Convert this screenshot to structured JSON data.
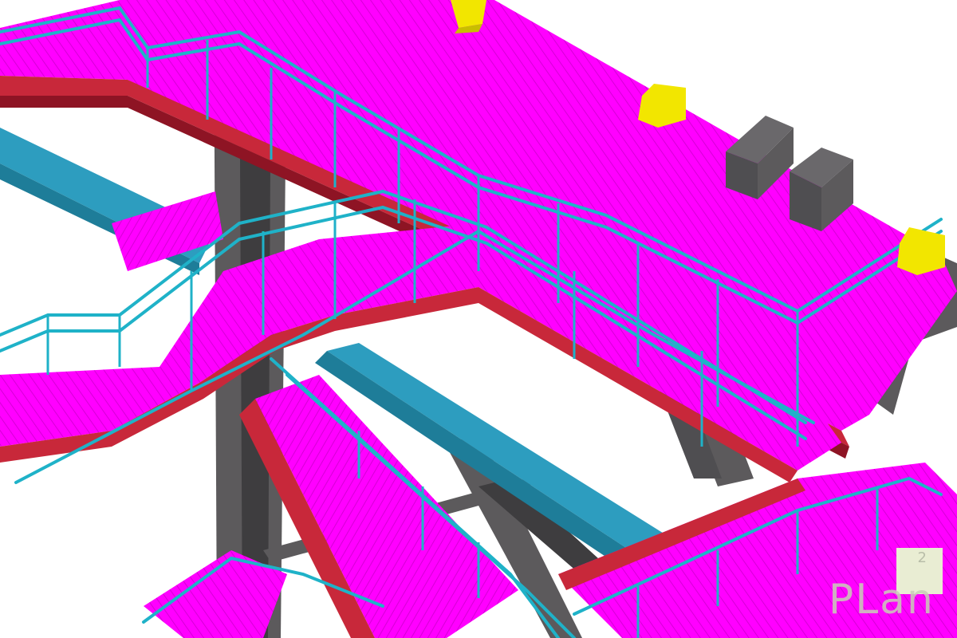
{
  "image": {
    "description_kind": "3D steel structure rendering",
    "colors": {
      "background": "#ffffff",
      "walkway": "#ff00ff",
      "walkway_shade": "#d600d6",
      "stringer": "#c8283a",
      "stringer_dark": "#8e1424",
      "railing": "#1fb2c8",
      "column": "#5c5a5c",
      "column_dark": "#3e3d3f",
      "beam_top": "#6a686b",
      "beam_side": "#4f4e51",
      "blue_beam": "#2d9dbf",
      "blue_beam_dark": "#1e7d99",
      "bracket": "#f2e600",
      "bracket_dark": "#c8be00"
    },
    "icons": [
      "column-icon",
      "beam-icon",
      "railing-icon",
      "bracket-icon"
    ]
  },
  "watermark": {
    "word": "PLan",
    "superscript": "2"
  }
}
